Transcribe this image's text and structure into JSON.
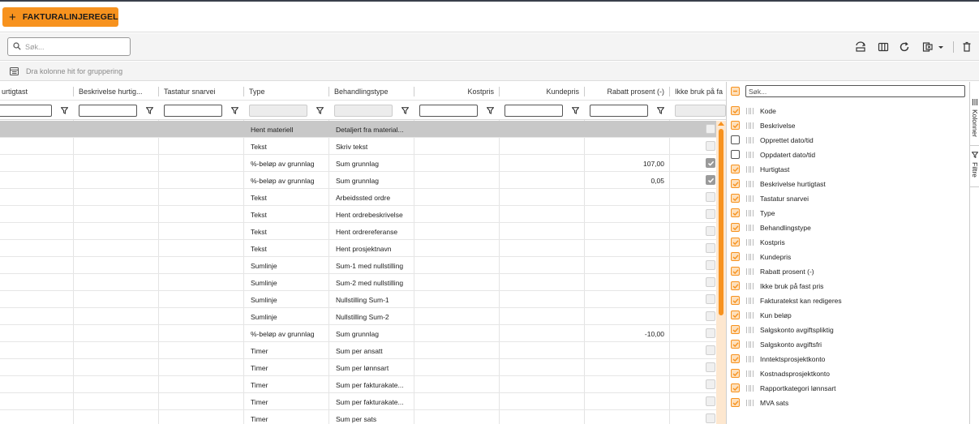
{
  "topbar": {
    "add_button_label": "FAKTURALINJEREGEL"
  },
  "toolbar": {
    "search_placeholder": "Søk...",
    "icons": [
      "reset-layout-icon",
      "columns-icon",
      "refresh-icon",
      "export-excel-icon",
      "delete-icon"
    ]
  },
  "groupbar": {
    "text": "Dra kolonne hit for gruppering"
  },
  "colors": {
    "accent": "#f7921e",
    "selected_row": "#c8c8c8"
  },
  "columns": [
    {
      "label": "urtigtast"
    },
    {
      "label": "Beskrivelse hurtig..."
    },
    {
      "label": "Tastatur snarvei"
    },
    {
      "label": "Type"
    },
    {
      "label": "Behandlingstype"
    },
    {
      "label": "Kostpris"
    },
    {
      "label": "Kundepris"
    },
    {
      "label": "Rabatt prosent (-)"
    },
    {
      "label": "Ikke bruk på fa"
    }
  ],
  "rows": [
    {
      "type": "Hent materiell",
      "behandling": "Detaljert fra material...",
      "rabatt": "",
      "ikke_bruk": false,
      "selected": true
    },
    {
      "type": "Tekst",
      "behandling": "Skriv tekst",
      "rabatt": "",
      "ikke_bruk": false
    },
    {
      "type": "%-beløp av grunnlag",
      "behandling": "Sum grunnlag",
      "rabatt": "107,00",
      "ikke_bruk": true
    },
    {
      "type": "%-beløp av grunnlag",
      "behandling": "Sum grunnlag",
      "rabatt": "0,05",
      "ikke_bruk": true
    },
    {
      "type": "Tekst",
      "behandling": "Arbeidssted ordre",
      "rabatt": "",
      "ikke_bruk": false
    },
    {
      "type": "Tekst",
      "behandling": "Hent ordrebeskrivelse",
      "rabatt": "",
      "ikke_bruk": false
    },
    {
      "type": "Tekst",
      "behandling": "Hent ordrereferanse",
      "rabatt": "",
      "ikke_bruk": false
    },
    {
      "type": "Tekst",
      "behandling": "Hent prosjektnavn",
      "rabatt": "",
      "ikke_bruk": false
    },
    {
      "type": "Sumlinje",
      "behandling": "Sum-1 med nullstilling",
      "rabatt": "",
      "ikke_bruk": false
    },
    {
      "type": "Sumlinje",
      "behandling": "Sum-2 med nullstilling",
      "rabatt": "",
      "ikke_bruk": false
    },
    {
      "type": "Sumlinje",
      "behandling": "Nullstilling Sum-1",
      "rabatt": "",
      "ikke_bruk": false
    },
    {
      "type": "Sumlinje",
      "behandling": "Nullstilling Sum-2",
      "rabatt": "",
      "ikke_bruk": false
    },
    {
      "type": "%-beløp av grunnlag",
      "behandling": "Sum grunnlag",
      "rabatt": "-10,00",
      "ikke_bruk": false
    },
    {
      "type": "Timer",
      "behandling": "Sum per ansatt",
      "rabatt": "",
      "ikke_bruk": false
    },
    {
      "type": "Timer",
      "behandling": "Sum per lønnsart",
      "rabatt": "",
      "ikke_bruk": false
    },
    {
      "type": "Timer",
      "behandling": "Sum per fakturakate...",
      "rabatt": "",
      "ikke_bruk": false
    },
    {
      "type": "Timer",
      "behandling": "Sum per fakturakate...",
      "rabatt": "",
      "ikke_bruk": false
    },
    {
      "type": "Timer",
      "behandling": "Sum per sats",
      "rabatt": "",
      "ikke_bruk": false
    }
  ],
  "column_panel": {
    "search_placeholder": "Søk...",
    "items": [
      {
        "label": "Kode",
        "checked": true
      },
      {
        "label": "Beskrivelse",
        "checked": true
      },
      {
        "label": "Opprettet dato/tid",
        "checked": false
      },
      {
        "label": "Oppdatert dato/tid",
        "checked": false
      },
      {
        "label": "Hurtigtast",
        "checked": true
      },
      {
        "label": "Beskrivelse hurtigtast",
        "checked": true
      },
      {
        "label": "Tastatur snarvei",
        "checked": true
      },
      {
        "label": "Type",
        "checked": true
      },
      {
        "label": "Behandlingstype",
        "checked": true
      },
      {
        "label": "Kostpris",
        "checked": true
      },
      {
        "label": "Kundepris",
        "checked": true
      },
      {
        "label": "Rabatt prosent (-)",
        "checked": true
      },
      {
        "label": "Ikke bruk på fast pris",
        "checked": true
      },
      {
        "label": "Fakturatekst kan redigeres",
        "checked": true
      },
      {
        "label": "Kun beløp",
        "checked": true
      },
      {
        "label": "Salgskonto avgiftspliktig",
        "checked": true
      },
      {
        "label": "Salgskonto avgiftsfri",
        "checked": true
      },
      {
        "label": "Inntektsprosjektkonto",
        "checked": true
      },
      {
        "label": "Kostnadsprosjektkonto",
        "checked": true
      },
      {
        "label": "Rapportkategori lønnsart",
        "checked": true
      },
      {
        "label": "MVA sats",
        "checked": true
      }
    ]
  },
  "side_tabs": [
    {
      "label": "Kolonner"
    },
    {
      "label": "Filtre"
    }
  ]
}
